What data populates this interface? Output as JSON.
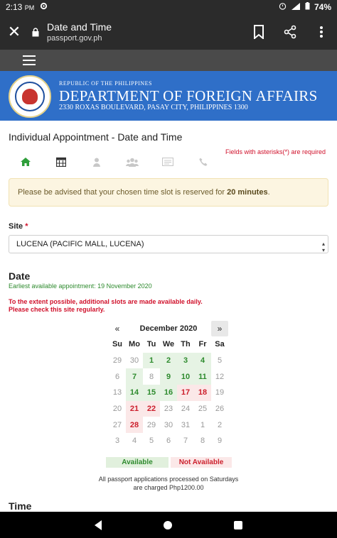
{
  "status": {
    "time": "2:13",
    "ampm": "PM",
    "battery": "74%"
  },
  "browser": {
    "title": "Date and Time",
    "url": "passport.gov.ph"
  },
  "banner": {
    "republic": "REPUBLIC OF THE PHILIPPINES",
    "department": "DEPARTMENT OF FOREIGN AFFAIRS",
    "address": "2330 ROXAS BOULEVARD, PASAY CITY, PHILIPPINES 1300"
  },
  "page": {
    "heading": "Individual Appointment - Date and Time"
  },
  "required_note": "Fields with asterisks(*) are required",
  "notice": {
    "prefix": "Please be advised that your chosen time slot is reserved for ",
    "bold": "20 minutes",
    "suffix": "."
  },
  "site": {
    "label": "Site",
    "star": "*",
    "value": "LUCENA (PACIFIC MALL, LUCENA)"
  },
  "date": {
    "label": "Date",
    "earliest": "Earliest available appointment: 19 November 2020",
    "extent_line1": "To the extent possible, additional slots are made available daily.",
    "extent_line2": "Please check this site regularly."
  },
  "calendar": {
    "prev": "«",
    "next": "»",
    "title": "December 2020",
    "days": [
      "Su",
      "Mo",
      "Tu",
      "We",
      "Th",
      "Fr",
      "Sa"
    ],
    "cells": [
      {
        "d": "29",
        "s": "muted"
      },
      {
        "d": "30",
        "s": "muted"
      },
      {
        "d": "1",
        "s": "avail"
      },
      {
        "d": "2",
        "s": "avail"
      },
      {
        "d": "3",
        "s": "avail"
      },
      {
        "d": "4",
        "s": "avail"
      },
      {
        "d": "5",
        "s": "muted"
      },
      {
        "d": "6",
        "s": "muted"
      },
      {
        "d": "7",
        "s": "avail"
      },
      {
        "d": "8",
        "s": "muted"
      },
      {
        "d": "9",
        "s": "avail"
      },
      {
        "d": "10",
        "s": "avail"
      },
      {
        "d": "11",
        "s": "avail"
      },
      {
        "d": "12",
        "s": "muted"
      },
      {
        "d": "13",
        "s": "muted"
      },
      {
        "d": "14",
        "s": "avail"
      },
      {
        "d": "15",
        "s": "avail"
      },
      {
        "d": "16",
        "s": "avail"
      },
      {
        "d": "17",
        "s": "na"
      },
      {
        "d": "18",
        "s": "na"
      },
      {
        "d": "19",
        "s": "muted"
      },
      {
        "d": "20",
        "s": "muted"
      },
      {
        "d": "21",
        "s": "na"
      },
      {
        "d": "22",
        "s": "na"
      },
      {
        "d": "23",
        "s": "muted"
      },
      {
        "d": "24",
        "s": "muted"
      },
      {
        "d": "25",
        "s": "muted"
      },
      {
        "d": "26",
        "s": "muted"
      },
      {
        "d": "27",
        "s": "muted"
      },
      {
        "d": "28",
        "s": "na"
      },
      {
        "d": "29",
        "s": "muted"
      },
      {
        "d": "30",
        "s": "muted"
      },
      {
        "d": "31",
        "s": "muted"
      },
      {
        "d": "1",
        "s": "muted"
      },
      {
        "d": "2",
        "s": "muted"
      },
      {
        "d": "3",
        "s": "muted"
      },
      {
        "d": "4",
        "s": "muted"
      },
      {
        "d": "5",
        "s": "muted"
      },
      {
        "d": "6",
        "s": "muted"
      },
      {
        "d": "7",
        "s": "muted"
      },
      {
        "d": "8",
        "s": "muted"
      },
      {
        "d": "9",
        "s": "muted"
      }
    ]
  },
  "legend": {
    "available": "Available",
    "not_available": "Not Available"
  },
  "saturday_note": "All passport applications processed on Saturdays are charged Php1200.00",
  "time": {
    "label": "Time"
  },
  "colors": {
    "banner": "#2f6fc8",
    "available": "#2e8b2e",
    "not_available": "#cc1f2c",
    "required": "#d0112b"
  },
  "icons": {
    "steps": [
      "home-icon",
      "calendar-icon",
      "person-icon",
      "group-icon",
      "card-icon",
      "phone-icon"
    ]
  }
}
